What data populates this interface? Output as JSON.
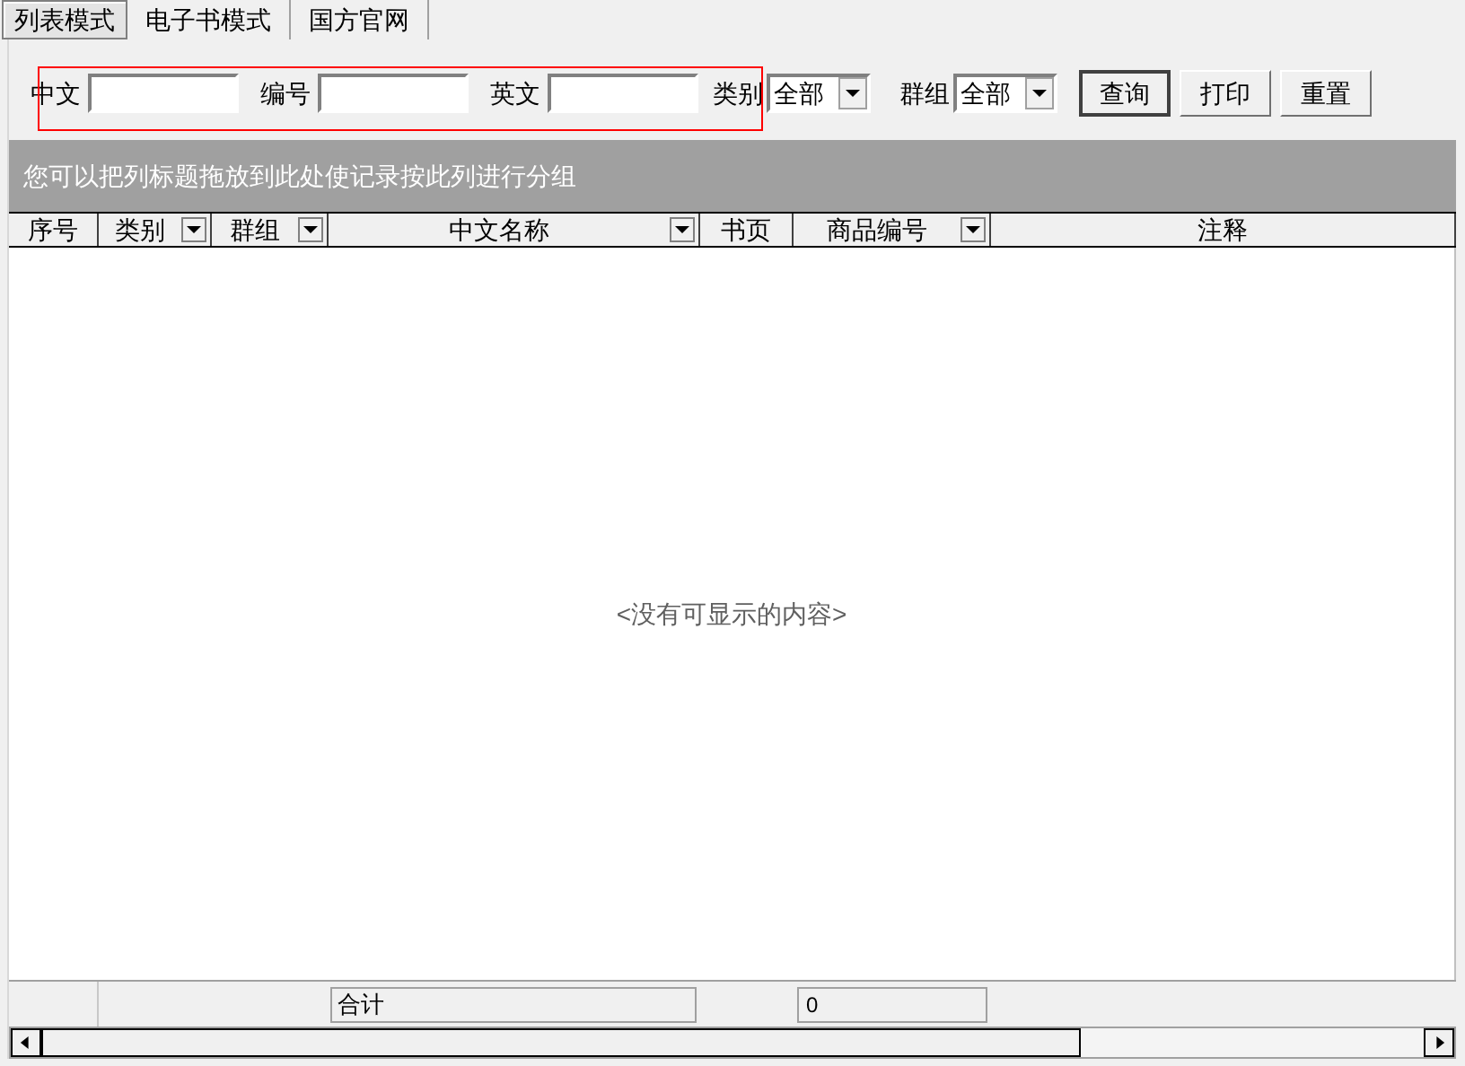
{
  "tabs": [
    {
      "label": "列表模式",
      "selected": true
    },
    {
      "label": "电子书模式",
      "selected": false
    },
    {
      "label": "国方官网",
      "selected": false
    }
  ],
  "filters": {
    "fields": [
      {
        "label": "中文"
      },
      {
        "label": "编号"
      },
      {
        "label": "英文"
      }
    ],
    "selects": [
      {
        "label": "类别",
        "value": "全部"
      },
      {
        "label": "群组",
        "value": "全部"
      }
    ],
    "buttons": [
      {
        "label": "查询",
        "default": true
      },
      {
        "label": "打印",
        "default": false
      },
      {
        "label": "重置",
        "default": false
      }
    ]
  },
  "group_bar": "您可以把列标题拖放到此处使记录按此列进行分组",
  "table": {
    "columns": [
      {
        "label": "序号",
        "filter": false
      },
      {
        "label": "类别",
        "filter": true
      },
      {
        "label": "群组",
        "filter": true
      },
      {
        "label": "中文名称",
        "filter": true
      },
      {
        "label": "书页",
        "filter": false
      },
      {
        "label": "商品编号",
        "filter": true
      },
      {
        "label": "注释",
        "filter": false
      }
    ],
    "empty_message": "<没有可显示的内容>",
    "footer": {
      "total_label": "合计",
      "total_value": "0"
    }
  }
}
